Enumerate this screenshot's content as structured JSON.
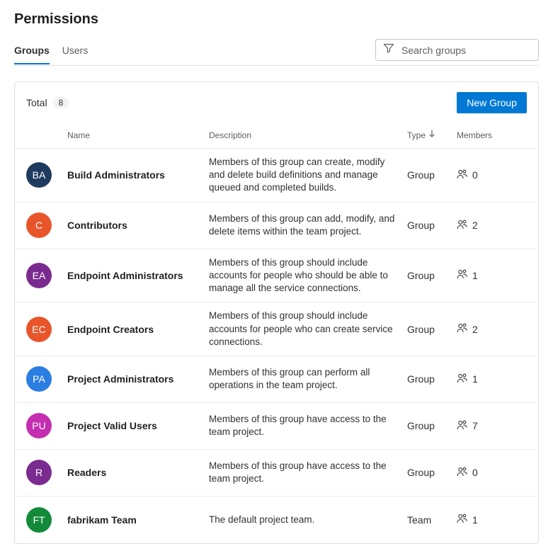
{
  "page": {
    "title": "Permissions"
  },
  "tabs": {
    "groups": "Groups",
    "users": "Users",
    "active": "groups"
  },
  "search": {
    "placeholder": "Search groups"
  },
  "card": {
    "total_label": "Total",
    "total_count": "8",
    "new_button": "New Group"
  },
  "columns": {
    "name": "Name",
    "description": "Description",
    "type": "Type",
    "members": "Members"
  },
  "rows": [
    {
      "initials": "BA",
      "color": "#1f3a5f",
      "name": "Build Administrators",
      "description": "Members of this group can create, modify and delete build definitions and manage queued and completed builds.",
      "type": "Group",
      "members": "0"
    },
    {
      "initials": "C",
      "color": "#e8552b",
      "name": "Contributors",
      "description": "Members of this group can add, modify, and delete items within the team project.",
      "type": "Group",
      "members": "2"
    },
    {
      "initials": "EA",
      "color": "#7a2b8f",
      "name": "Endpoint Administrators",
      "description": "Members of this group should include accounts for people who should be able to manage all the service connections.",
      "type": "Group",
      "members": "1"
    },
    {
      "initials": "EC",
      "color": "#e8552b",
      "name": "Endpoint Creators",
      "description": "Members of this group should include accounts for people who can create service connections.",
      "type": "Group",
      "members": "2"
    },
    {
      "initials": "PA",
      "color": "#2a7de1",
      "name": "Project Administrators",
      "description": "Members of this group can perform all operations in the team project.",
      "type": "Group",
      "members": "1"
    },
    {
      "initials": "PU",
      "color": "#c42eb0",
      "name": "Project Valid Users",
      "description": "Members of this group have access to the team project.",
      "type": "Group",
      "members": "7"
    },
    {
      "initials": "R",
      "color": "#7a2b8f",
      "name": "Readers",
      "description": "Members of this group have access to the team project.",
      "type": "Group",
      "members": "0"
    },
    {
      "initials": "FT",
      "color": "#128a3a",
      "name": "fabrikam Team",
      "description": "The default project team.",
      "type": "Team",
      "members": "1"
    }
  ]
}
